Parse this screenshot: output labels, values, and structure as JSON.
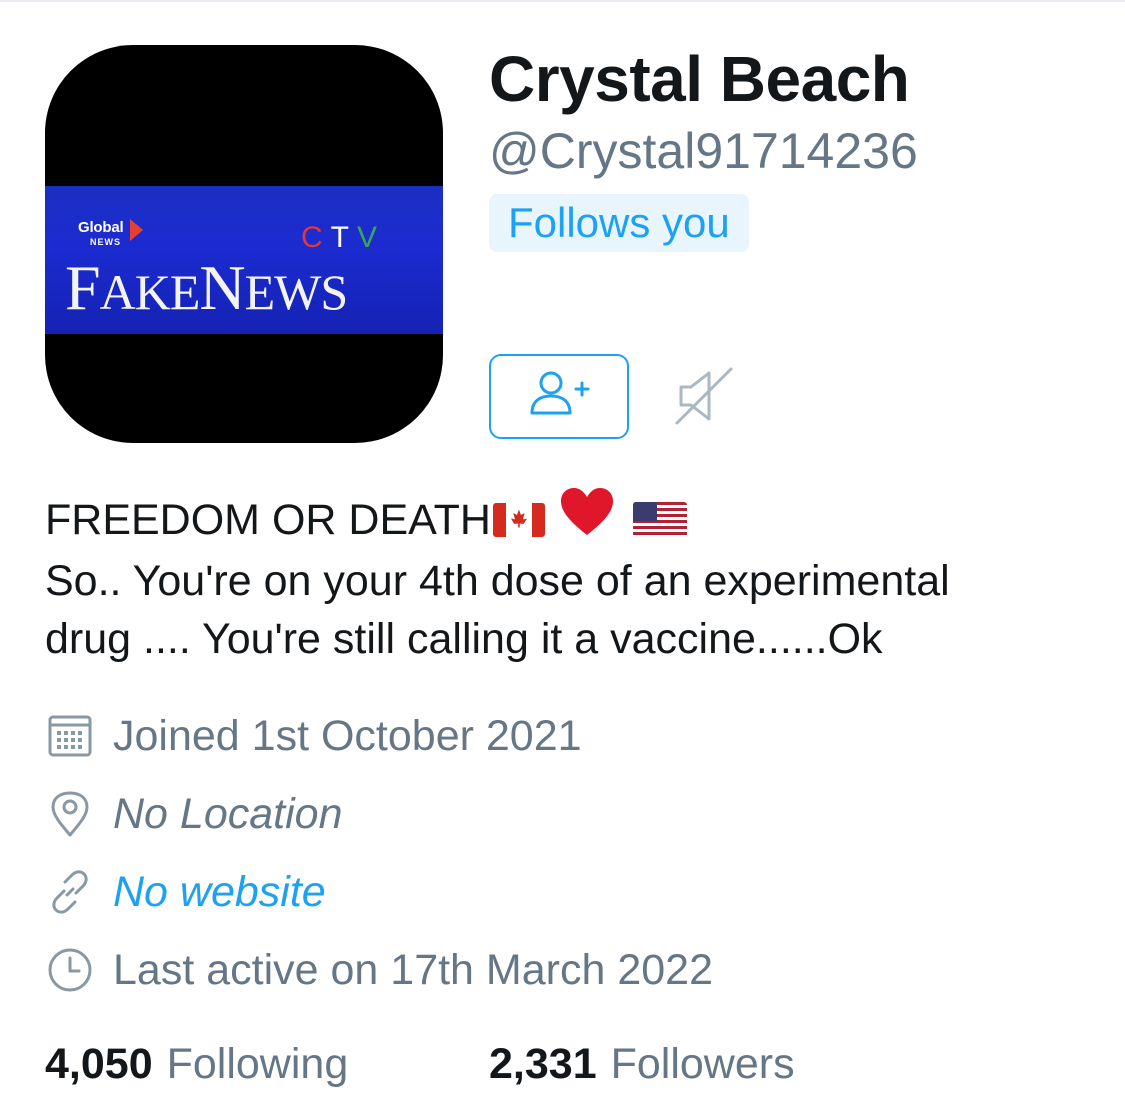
{
  "profile": {
    "display_name": "Crystal Beach",
    "handle": "@Crystal91714236",
    "follows_you_badge": "Follows you",
    "avatar": {
      "global_logo_text": "Global",
      "global_news_text": "NEWS",
      "ctv_letters": [
        "C",
        "T",
        "V"
      ],
      "headline_text": "FakeNews"
    }
  },
  "actions": {
    "follow_icon": "add-user-icon",
    "mute_icon": "muted-speaker-icon",
    "accent_color": "#1da1f2"
  },
  "bio": {
    "line1": "FREEDOM OR DEATH",
    "line1_emojis": [
      "canadian-flag",
      "red-heart",
      "us-flag"
    ],
    "line2": "So.. You're on your 4th dose of an experimental",
    "line3": "drug .... You're still calling it a vaccine......Ok"
  },
  "meta": {
    "joined": "Joined 1st October 2021",
    "location": "No Location",
    "website": "No website",
    "last_active": "Last active on 17th March 2022"
  },
  "stats": {
    "following_count": "4,050",
    "following_label": "Following",
    "followers_count": "2,331",
    "followers_label": "Followers"
  },
  "colors": {
    "text_primary": "#14171a",
    "text_secondary": "#657786",
    "accent": "#1da1f2",
    "badge_bg": "#e8f5fd"
  }
}
